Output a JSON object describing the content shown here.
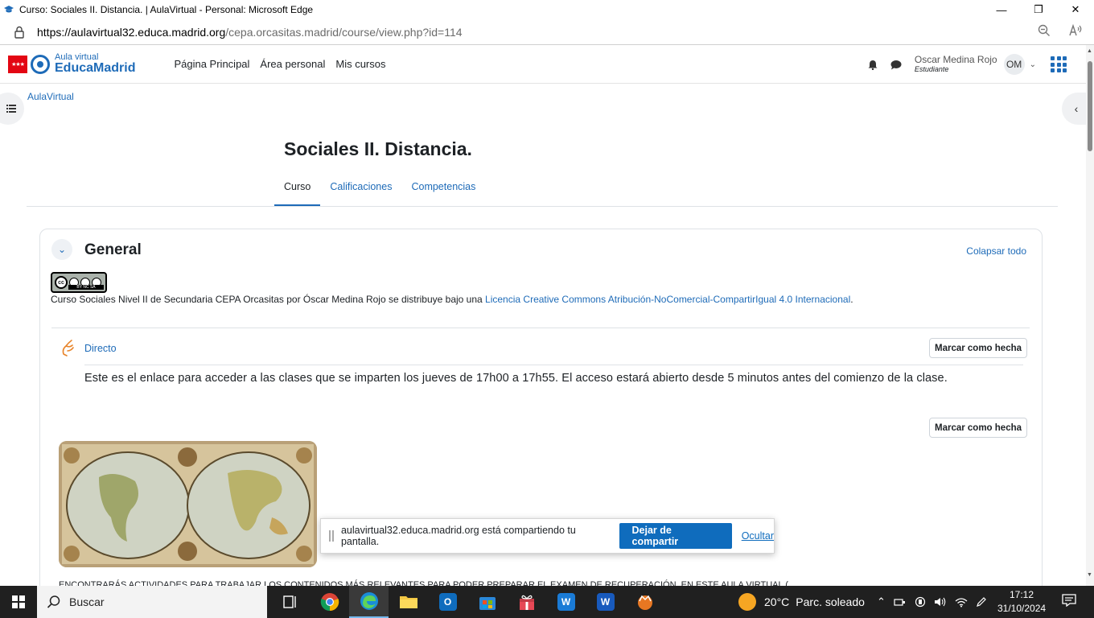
{
  "browser": {
    "window_title": "Curso: Sociales II. Distancia. | AulaVirtual - Personal: Microsoft Edge",
    "url_host": "https://aulavirtual32.educa.madrid.org",
    "url_path": "/cepa.orcasitas.madrid/course/view.php?id=114",
    "controls": {
      "minimize": "—",
      "restore": "❐",
      "close": "✕"
    }
  },
  "navbar": {
    "logo_line1": "Aula virtual",
    "logo_line2": "EducaMadrid",
    "links": [
      "Página Principal",
      "Área personal",
      "Mis cursos"
    ],
    "user_name": "Oscar Medina Rojo",
    "user_role": "Estudiante",
    "avatar_initials": "OM"
  },
  "breadcrumb": "AulaVirtual",
  "course": {
    "title": "Sociales II. Distancia.",
    "tabs": [
      "Curso",
      "Calificaciones",
      "Competencias"
    ],
    "active_tab": "Curso"
  },
  "section": {
    "title": "General",
    "collapse_all": "Colapsar todo",
    "license_text": "Curso Sociales Nivel II de Secundaria CEPA Orcasitas por Óscar Medina Rojo se distribuye bajo una ",
    "license_link": "Licencia Creative Commons Atribución-NoComercial-CompartirIgual 4.0 Internacional",
    "license_end": ".",
    "activity_name": "Directo",
    "mark_done": "Marcar como hecha",
    "activity_desc": "Este es el enlace para acceder a las clases que se imparten los jueves de 17h00 a 17h55. El acceso estará abierto desde 5 minutos antes del comienzo de la clase.",
    "bottom_text": "ENCONTRARÁS ACTIVIDADES PARA TRABAJAR LOS CONTENIDOS MÁS RELEVANTES PARA PODER PREPARAR EL EXAMEN DE RECUPERACIÓN, EN ESTE AULA VIRTUAL (..."
  },
  "sharebar": {
    "message": "aulavirtual32.educa.madrid.org está compartiendo tu pantalla.",
    "stop_label": "Dejar de compartir",
    "hide_label": "Ocultar"
  },
  "taskbar": {
    "search_placeholder": "Buscar",
    "weather_temp": "20°C",
    "weather_desc": "Parc. soleado",
    "time": "17:12",
    "date": "31/10/2024"
  },
  "colors": {
    "link_blue": "#1e6bb8",
    "primary_button": "#0f6cbd",
    "madrid_red": "#e30613",
    "taskbar_bg": "#202020"
  }
}
